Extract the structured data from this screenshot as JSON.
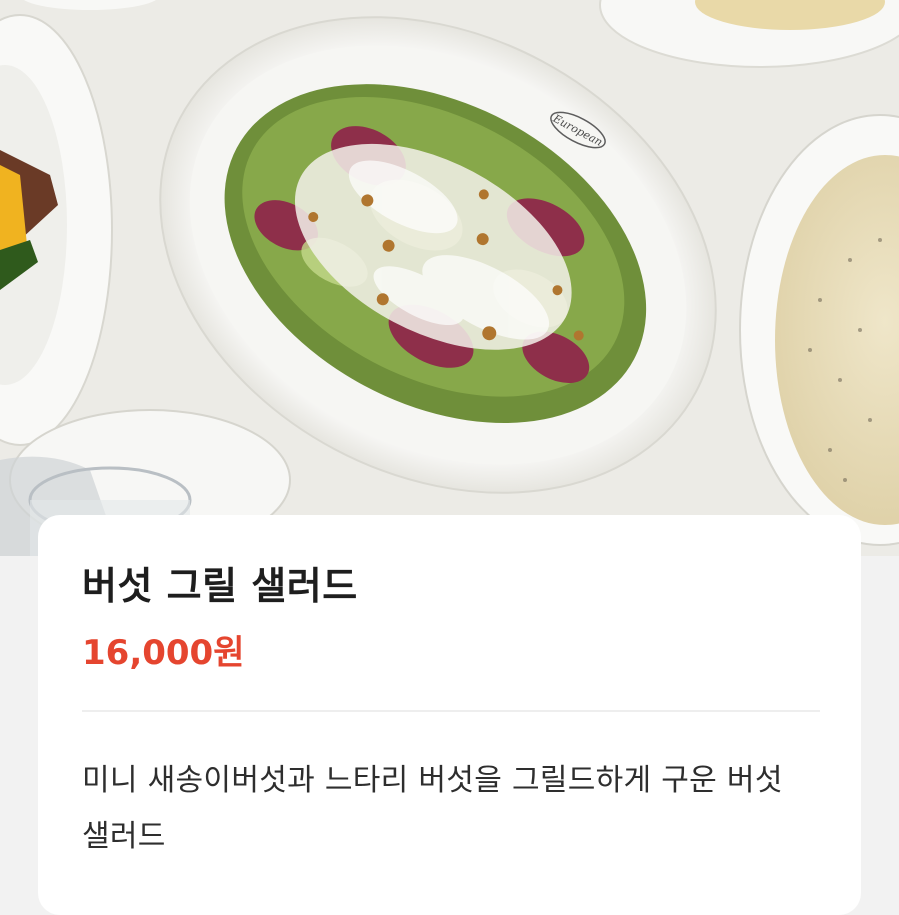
{
  "menu_item": {
    "photo_alt": "Mushroom grill salad on an oval white plate",
    "plate_brand": "European",
    "name": "버섯 그릴 샐러드",
    "price": "16,000원",
    "description": "미니 새송이버섯과 느타리 버섯을 그릴드하게 구운 버섯 샐러드"
  },
  "colors": {
    "price": "#e5452f",
    "card_background": "#ffffff",
    "photo_background": "#ecebe6"
  }
}
